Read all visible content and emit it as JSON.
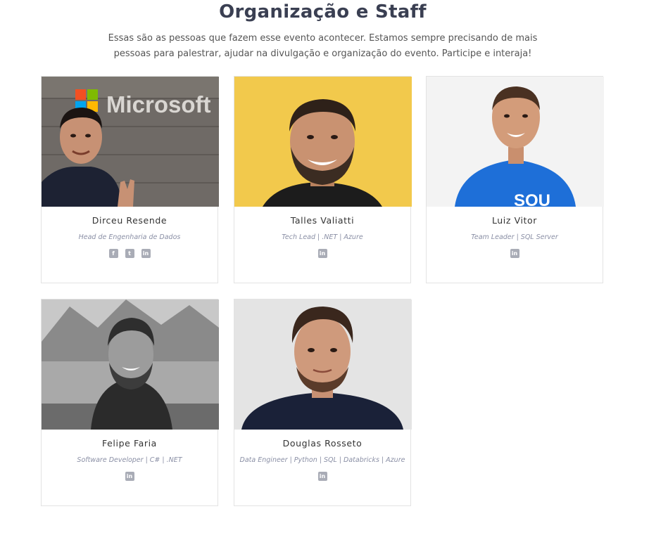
{
  "section": {
    "title": "Organização e Staff",
    "intro": "Essas são as pessoas que fazem esse evento acontecer. Estamos sempre precisando de mais pessoas para palestrar, ajudar na divulgação e organização do evento. Participe e interaja!"
  },
  "members": [
    {
      "name": "Dirceu Resende",
      "role": "Head de Engenharia de Dados",
      "socials": [
        "facebook-icon",
        "twitter-icon",
        "linkedin-icon"
      ]
    },
    {
      "name": "Talles Valiatti",
      "role": "Tech Lead | .NET | Azure",
      "socials": [
        "linkedin-icon"
      ]
    },
    {
      "name": "Luiz Vitor",
      "role": "Team Leader | SQL Server",
      "socials": [
        "linkedin-icon"
      ]
    },
    {
      "name": "Felipe Faria",
      "role": "Software Developer | C# | .NET",
      "socials": [
        "linkedin-icon"
      ]
    },
    {
      "name": "Douglas Rosseto",
      "role": "Data Engineer | Python | SQL | Databricks | Azure",
      "socials": [
        "linkedin-icon"
      ]
    }
  ],
  "photo_texts": {
    "microsoft_sign": "Microsoft",
    "shirt_text": "SOU"
  },
  "colors": {
    "title": "#3a3f52",
    "role": "#8a8fa5",
    "icon": "#a9acb6",
    "border": "#e3e3e3"
  }
}
